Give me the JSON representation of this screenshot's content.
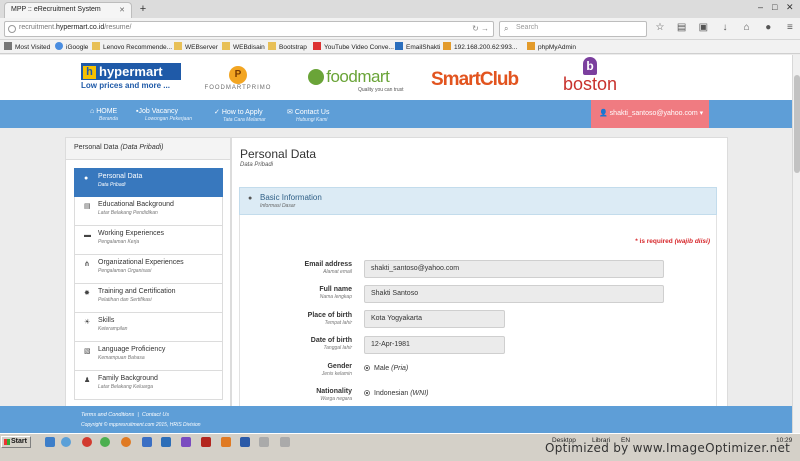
{
  "browser": {
    "tab_title": "MPP :: eRecruitment System",
    "url_prefix": "recruitment.",
    "url_domain": "hypermart.co.id",
    "url_path": "/resume/",
    "search_placeholder": "Search"
  },
  "bookmarks": [
    "Most Visited",
    "iGoogle",
    "Lenovo Recommende...",
    "WEBserver",
    "WEBdisain",
    "Bootstrap",
    "YouTube Video Conve...",
    "EmailShakti",
    "192.168.200.62:993...",
    "phpMyAdmin"
  ],
  "logos": {
    "hypermart_name": "hypermart",
    "hypermart_tag": "Low prices and more ...",
    "prima_letter": "P",
    "prima_name": "FOODMARTPRIMO",
    "foodmart_name": "foodmart",
    "foodmart_tag": "Quality you can trust",
    "smartclub_name": "SmartClub",
    "boston_name": "boston"
  },
  "nav": {
    "items": [
      {
        "label": "HOME",
        "sub": "Beranda"
      },
      {
        "label": "Job Vacancy",
        "sub": "Lowongan Pekerjaan"
      },
      {
        "label": "How to Apply",
        "sub": "Tata Cara Melamar"
      },
      {
        "label": "Contact Us",
        "sub": "Hubungi Kami"
      }
    ],
    "user": "shakti_santoso@yahoo.com"
  },
  "sidebar": {
    "title": "Personal Data",
    "title_sub": "(Data Pribadi)",
    "items": [
      {
        "label": "Personal Data",
        "sub": "Data Pribadi",
        "icon": "user-icon"
      },
      {
        "label": "Educational Background",
        "sub": "Latar Belakang Pendidikan",
        "icon": "book-icon"
      },
      {
        "label": "Working Experiences",
        "sub": "Pengalaman Kerja",
        "icon": "briefcase-icon"
      },
      {
        "label": "Organizational Experiences",
        "sub": "Pengalaman Organisasi",
        "icon": "sitemap-icon"
      },
      {
        "label": "Training and Certification",
        "sub": "Pelatihan dan Sertifikasi",
        "icon": "certificate-icon"
      },
      {
        "label": "Skills",
        "sub": "Keterampilan",
        "icon": "lightbulb-icon"
      },
      {
        "label": "Language Proficiency",
        "sub": "Kemampuan Bahasa",
        "icon": "language-icon"
      },
      {
        "label": "Family Background",
        "sub": "Latar Belakang Keluarga",
        "icon": "users-icon"
      }
    ]
  },
  "main": {
    "title": "Personal Data",
    "subtitle": "Data Pribadi",
    "section_title": "Basic Information",
    "section_sub": "Informasi Dasar",
    "required_note_1": "* is required",
    "required_note_2": "(wajib diisi)",
    "fields": {
      "email": {
        "label": "Email address",
        "sub": "Alamat email",
        "value": "shakti_santoso@yahoo.com"
      },
      "fullname": {
        "label": "Full name",
        "sub": "Nama lengkap",
        "value": "Shakti Santoso"
      },
      "birthplace": {
        "label": "Place of birth",
        "sub": "Tempat lahir",
        "value": "Kota Yogyakarta"
      },
      "birthdate": {
        "label": "Date of birth",
        "sub": "Tanggal lahir",
        "value": "12-Apr-1981"
      },
      "gender": {
        "label": "Gender",
        "sub": "Jenis kelamin",
        "value": "Male",
        "value_note": "(Pria)"
      },
      "nationality": {
        "label": "Nationality",
        "sub": "Warga negara",
        "value": "Indonesian",
        "value_note": "(WNI)"
      }
    }
  },
  "footer": {
    "terms": "Terms and Conditions",
    "sep": "|",
    "contact": "Contact Us",
    "copyright": "Copyright © mppresruitment.com 2015, HRIS Division"
  },
  "taskbar": {
    "start": "Start",
    "desktop": "Desktop",
    "library": "Librari",
    "lang": "EN",
    "clock": "10:29"
  },
  "watermark": "Optimized by www.ImageOptimizer.net"
}
